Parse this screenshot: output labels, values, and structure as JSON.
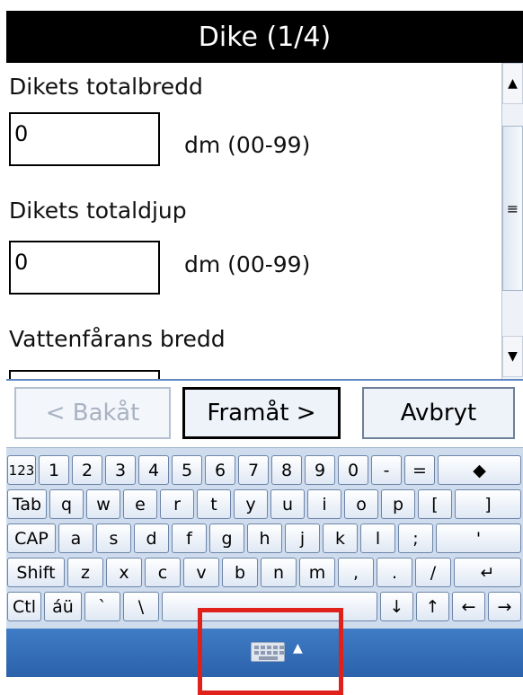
{
  "title": "Dike (1/4)",
  "form": {
    "field1_label": "Dikets totalbredd",
    "field1_value": "0",
    "field1_unit": "dm (00-99)",
    "field2_label": "Dikets totaldjup",
    "field2_value": "0",
    "field2_unit": "dm (00-99)",
    "field3_label": "Vattenfårans bredd"
  },
  "scrollbar": {
    "up": "▲",
    "thumb": "≡",
    "down": "▼"
  },
  "nav": {
    "back": "< Bakåt",
    "next": "Framåt >",
    "cancel": "Avbryt"
  },
  "keyboard": {
    "row1": [
      "123",
      "1",
      "2",
      "3",
      "4",
      "5",
      "6",
      "7",
      "8",
      "9",
      "0",
      "-",
      "=",
      "◆"
    ],
    "row2": [
      "Tab",
      "q",
      "w",
      "e",
      "r",
      "t",
      "y",
      "u",
      "i",
      "o",
      "p",
      "[",
      "]"
    ],
    "row3": [
      "CAP",
      "a",
      "s",
      "d",
      "f",
      "g",
      "h",
      "j",
      "k",
      "l",
      ";",
      "'"
    ],
    "row4": [
      "Shift",
      "z",
      "x",
      "c",
      "v",
      "b",
      "n",
      "m",
      ",",
      ".",
      "/",
      "↵"
    ],
    "row5": [
      "Ctl",
      "áü",
      "`",
      "\\",
      "",
      "↓",
      "↑",
      "←",
      "→"
    ]
  },
  "taskbar": {
    "caret": "▲"
  },
  "colors": {
    "highlight": "#e0201b",
    "taskbar": "#3f7cc6",
    "keyboard_bg": "#cfdcee"
  }
}
